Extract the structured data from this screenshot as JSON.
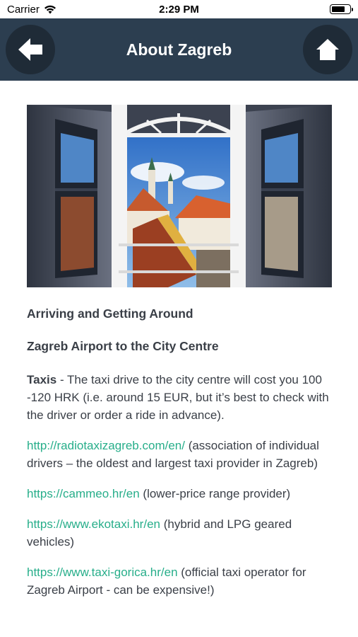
{
  "status_bar": {
    "carrier": "Carrier",
    "time": "2:29 PM",
    "battery_level": 0.8
  },
  "navbar": {
    "title": "About Zagreb",
    "back_icon": "arrow-left-icon",
    "home_icon": "home-icon",
    "background": "#2c3e50"
  },
  "article": {
    "heading_1": "Arriving and Getting Around",
    "heading_2": "Zagreb Airport to the City Centre",
    "taxis_label": "Taxis",
    "taxis_text": " - The taxi drive to the city centre will cost you 100 -120 HRK (i.e. around 15 EUR, but it’s best to check with the driver or order a ride in advance).",
    "links": [
      {
        "url": "http://radiotaxizagreb.com/en/",
        "desc": " (association of individual drivers – the oldest and largest taxi provider in Zagreb)"
      },
      {
        "url": "https://cammeo.hr/en",
        "desc": " (lower-price range provider)"
      },
      {
        "url": "https://www.ekotaxi.hr/en",
        "desc": " (hybrid and LPG geared vehicles)"
      },
      {
        "url": "https://www.taxi-gorica.hr/en",
        "desc": "  (official taxi operator for Zagreb Airport - can be expensive!)"
      }
    ],
    "link_color": "#27ae8a"
  }
}
